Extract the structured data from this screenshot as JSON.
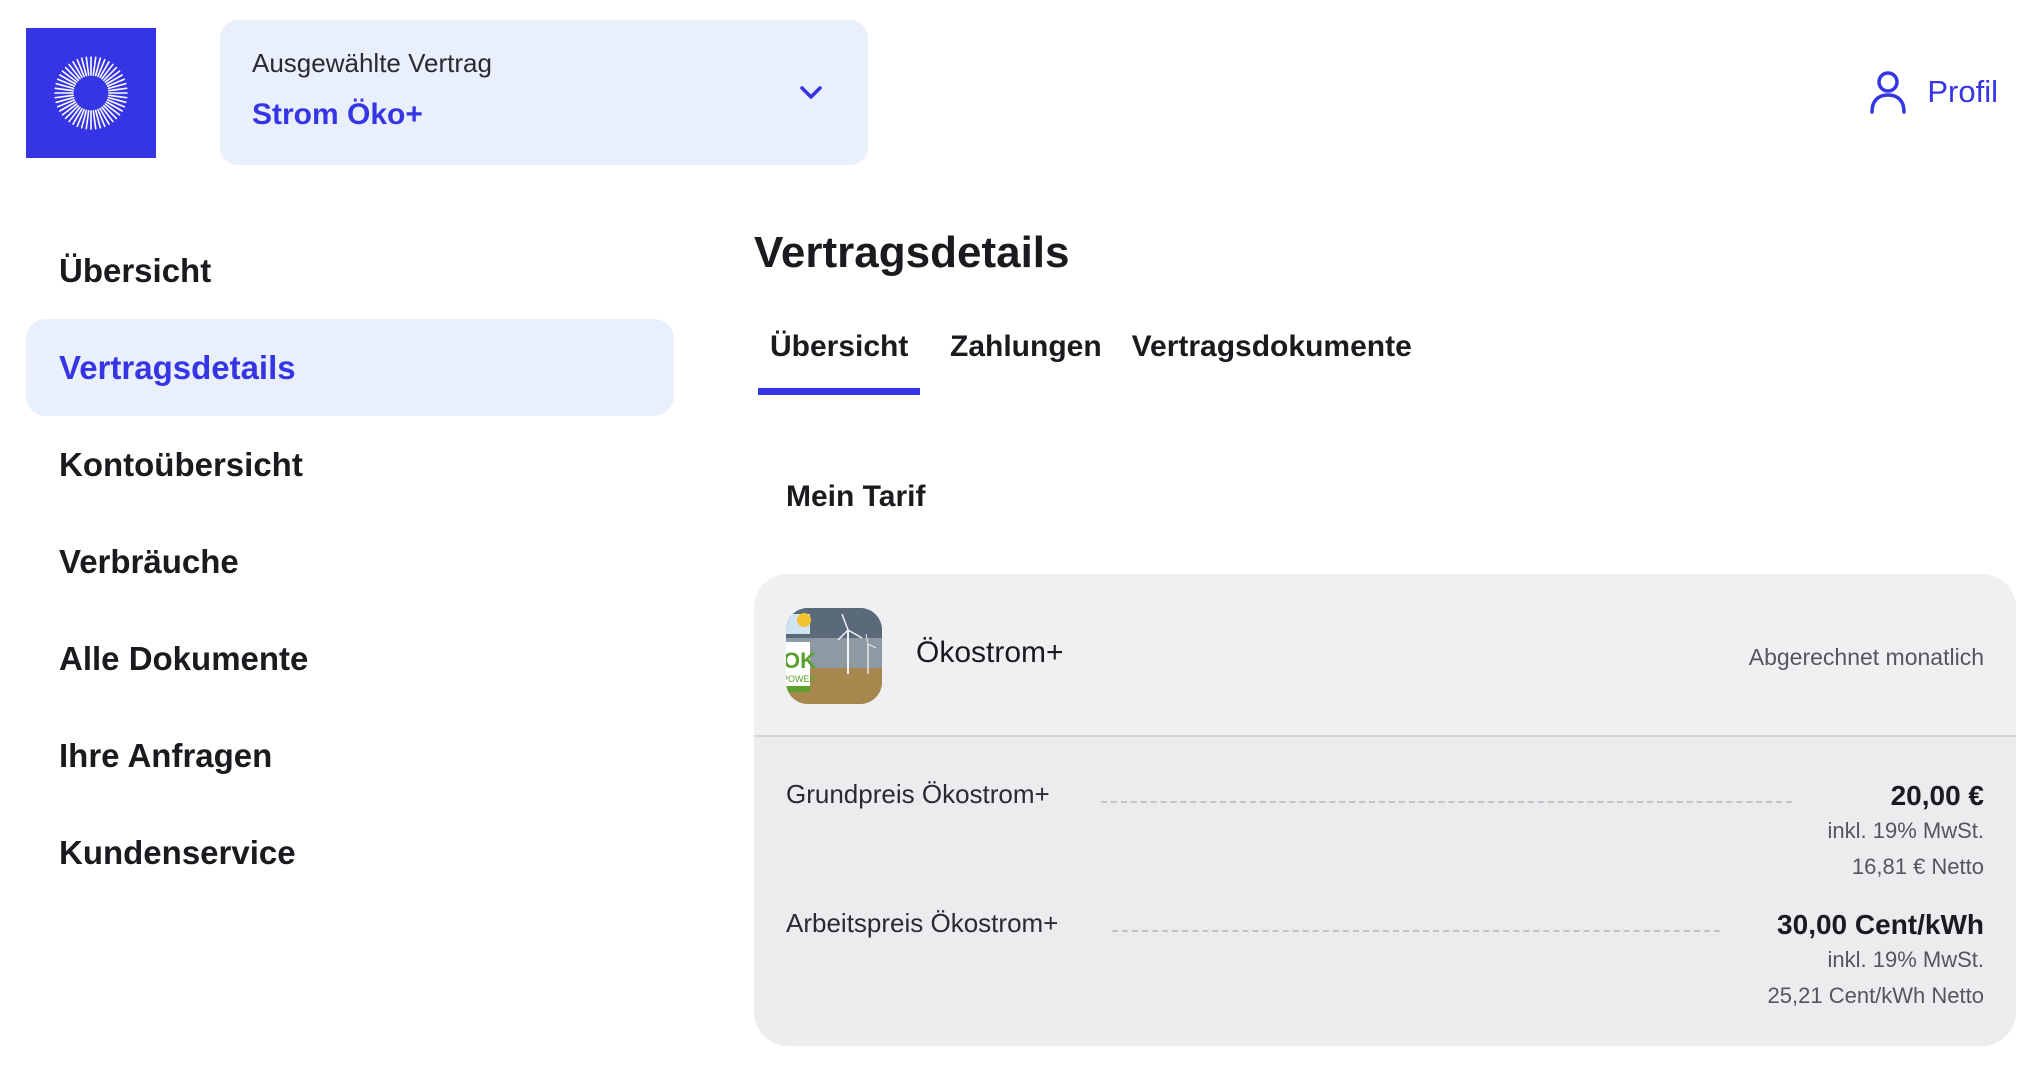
{
  "header": {
    "contract_label": "Ausgewählte Vertrag",
    "contract_value": "Strom Öko+",
    "profile_label": "Profil"
  },
  "sidebar": {
    "items": [
      {
        "label": "Übersicht",
        "active": false
      },
      {
        "label": "Vertragsdetails",
        "active": true
      },
      {
        "label": "Kontoübersicht",
        "active": false
      },
      {
        "label": "Verbräuche",
        "active": false
      },
      {
        "label": "Alle Dokumente",
        "active": false
      },
      {
        "label": "Ihre Anfragen",
        "active": false
      },
      {
        "label": "Kundenservice",
        "active": false
      }
    ]
  },
  "main": {
    "title": "Vertragsdetails",
    "tabs": [
      {
        "label": "Übersicht",
        "active": true
      },
      {
        "label": "Zahlungen",
        "active": false
      },
      {
        "label": "Vertragsdokumente",
        "active": false
      }
    ],
    "section_title": "Mein Tarif",
    "tariff": {
      "name": "Ökostrom+",
      "billing": "Abgerechnet monatlich",
      "thumb_badge": "OK",
      "thumb_badge_sub": "POWER",
      "prices": [
        {
          "label": "Grundpreis Ökostrom+",
          "amount": "20,00 €",
          "tax_note": "inkl. 19% MwSt.",
          "net": "16,81 € Netto"
        },
        {
          "label": "Arbeitspreis Ökostrom+",
          "amount": "30,00 Cent/kWh",
          "tax_note": "inkl. 19% MwSt.",
          "net": "25,21 Cent/kWh Netto"
        }
      ]
    }
  },
  "colors": {
    "accent": "#3535e6",
    "accent_light": "#eaeffc",
    "card_bg": "#ececef",
    "text": "#1a1a1f"
  },
  "icons": {
    "logo": "sunburst-logo-icon",
    "dropdown": "chevron-down-icon",
    "profile": "user-icon"
  }
}
